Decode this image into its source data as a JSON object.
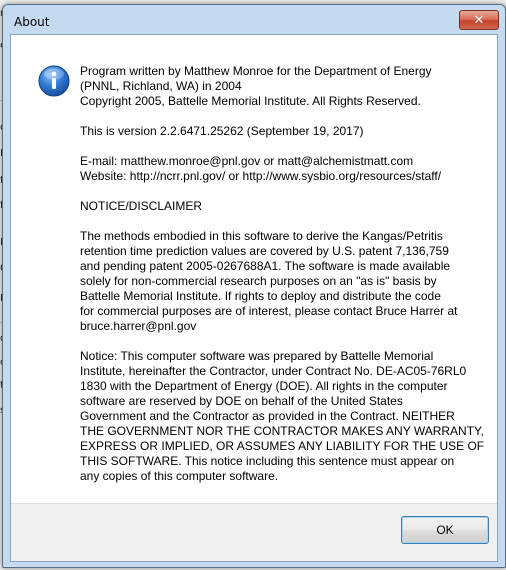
{
  "window": {
    "title": "About",
    "close_glyph": "✕"
  },
  "icon": "information-icon",
  "message": {
    "paragraphs": [
      "Program written by Matthew Monroe for the Department of Energy\n(PNNL, Richland, WA) in 2004\nCopyright 2005, Battelle Memorial Institute.  All Rights Reserved.",
      "This is version 2.2.6471.25262 (September 19, 2017)",
      "E-mail: matthew.monroe@pnl.gov or matt@alchemistmatt.com\nWebsite: http://ncrr.pnl.gov/ or http://www.sysbio.org/resources/staff/",
      "NOTICE/DISCLAIMER",
      "The methods embodied in this software to derive the Kangas/Petritis\nretention time prediction values are covered by U.S. patent 7,136,759\nand pending patent 2005-0267688A1.  The software is made available\nsolely for non-commercial research purposes on an \"as is\" basis by\nBattelle Memorial Institute.  If rights to deploy and distribute  the code\nfor commercial purposes are of interest, please contact Bruce Harrer at\nbruce.harrer@pnl.gov",
      "Notice: This computer software was prepared by Battelle Memorial\nInstitute, hereinafter the Contractor, under Contract No. DE-AC05-76RL0\n1830 with the Department of Energy (DOE).  All rights in the computer\nsoftware are reserved by DOE on behalf of the United States\nGovernment and the Contractor as provided in the Contract.  NEITHER\nTHE GOVERNMENT NOR THE CONTRACTOR MAKES ANY WARRANTY,\nEXPRESS OR IMPLIED, OR ASSUMES ANY LIABILITY FOR THE USE OF\nTHIS SOFTWARE.  This notice including this sentence must appear on\nany copies of this computer software."
    ]
  },
  "buttons": {
    "ok_label": "OK"
  },
  "background_app": {
    "left_fragments": [
      "n",
      "e",
      "op",
      "Ir",
      "ff",
      "ff",
      "Ir",
      "0(",
      "De",
      "d",
      "ob",
      "t",
      "s"
    ],
    "right_fragments": [
      "re"
    ]
  },
  "colors": {
    "title_bar": "#c3daf0",
    "close_button": "#c4422a",
    "info_icon": "#1f5fb5",
    "ok_border": "#3c7fb1"
  }
}
